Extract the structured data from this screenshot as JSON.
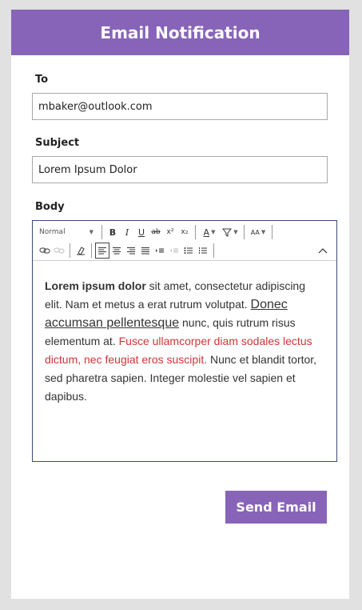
{
  "header": {
    "title": "Email Notification"
  },
  "form": {
    "to": {
      "label": "To",
      "value": "mbaker@outlook.com"
    },
    "subject": {
      "label": "Subject",
      "value": "Lorem Ipsum Dolor"
    },
    "body": {
      "label": "Body",
      "toolbar": {
        "font_style": "Normal",
        "bold": "B",
        "italic": "I",
        "underline": "U",
        "strikethrough": "ab",
        "superscript": "x²",
        "subscript": "x₂",
        "font_color": "A",
        "font_size": "AA"
      },
      "content": {
        "bold_text": "Lorem ipsum dolor",
        "text_1": " sit amet, consectetur adipiscing elit. Nam et metus a erat rutrum volutpat. ",
        "link_text": "Donec accumsan pellentesque",
        "text_2": " nunc, quis rutrum risus elementum at. ",
        "red_text": "Fusce ullamcorper diam sodales lectus dictum, nec feugiat eros suscipit.",
        "text_3": " Nunc et blandit tortor, sed pharetra sapien. Integer molestie vel sapien et dapibus."
      }
    }
  },
  "actions": {
    "send_label": "Send Email"
  },
  "colors": {
    "accent": "#8764b8",
    "highlight_text": "#d13438",
    "editor_border": "#3c4a7a",
    "input_border": "#a8a8a8"
  }
}
